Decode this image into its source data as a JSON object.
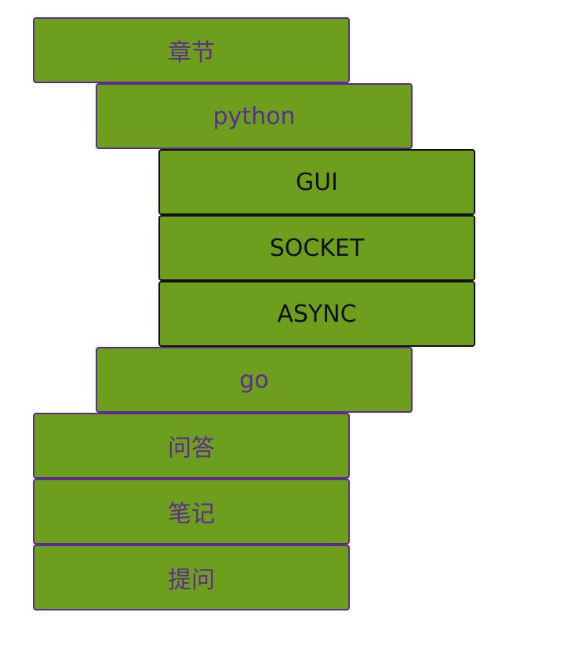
{
  "menu": {
    "chapter": "章节",
    "python": {
      "label": "python",
      "children": [
        "GUI",
        "SOCKET",
        "ASYNC"
      ]
    },
    "go": "go",
    "qa": "问答",
    "notes": "笔记",
    "ask": "提问"
  },
  "colors": {
    "box_fill": "#6e9e1e",
    "border_purple": "#5b2d8e",
    "border_black": "#111111",
    "text_purple": "#5b2d8e",
    "text_black": "#111111"
  }
}
